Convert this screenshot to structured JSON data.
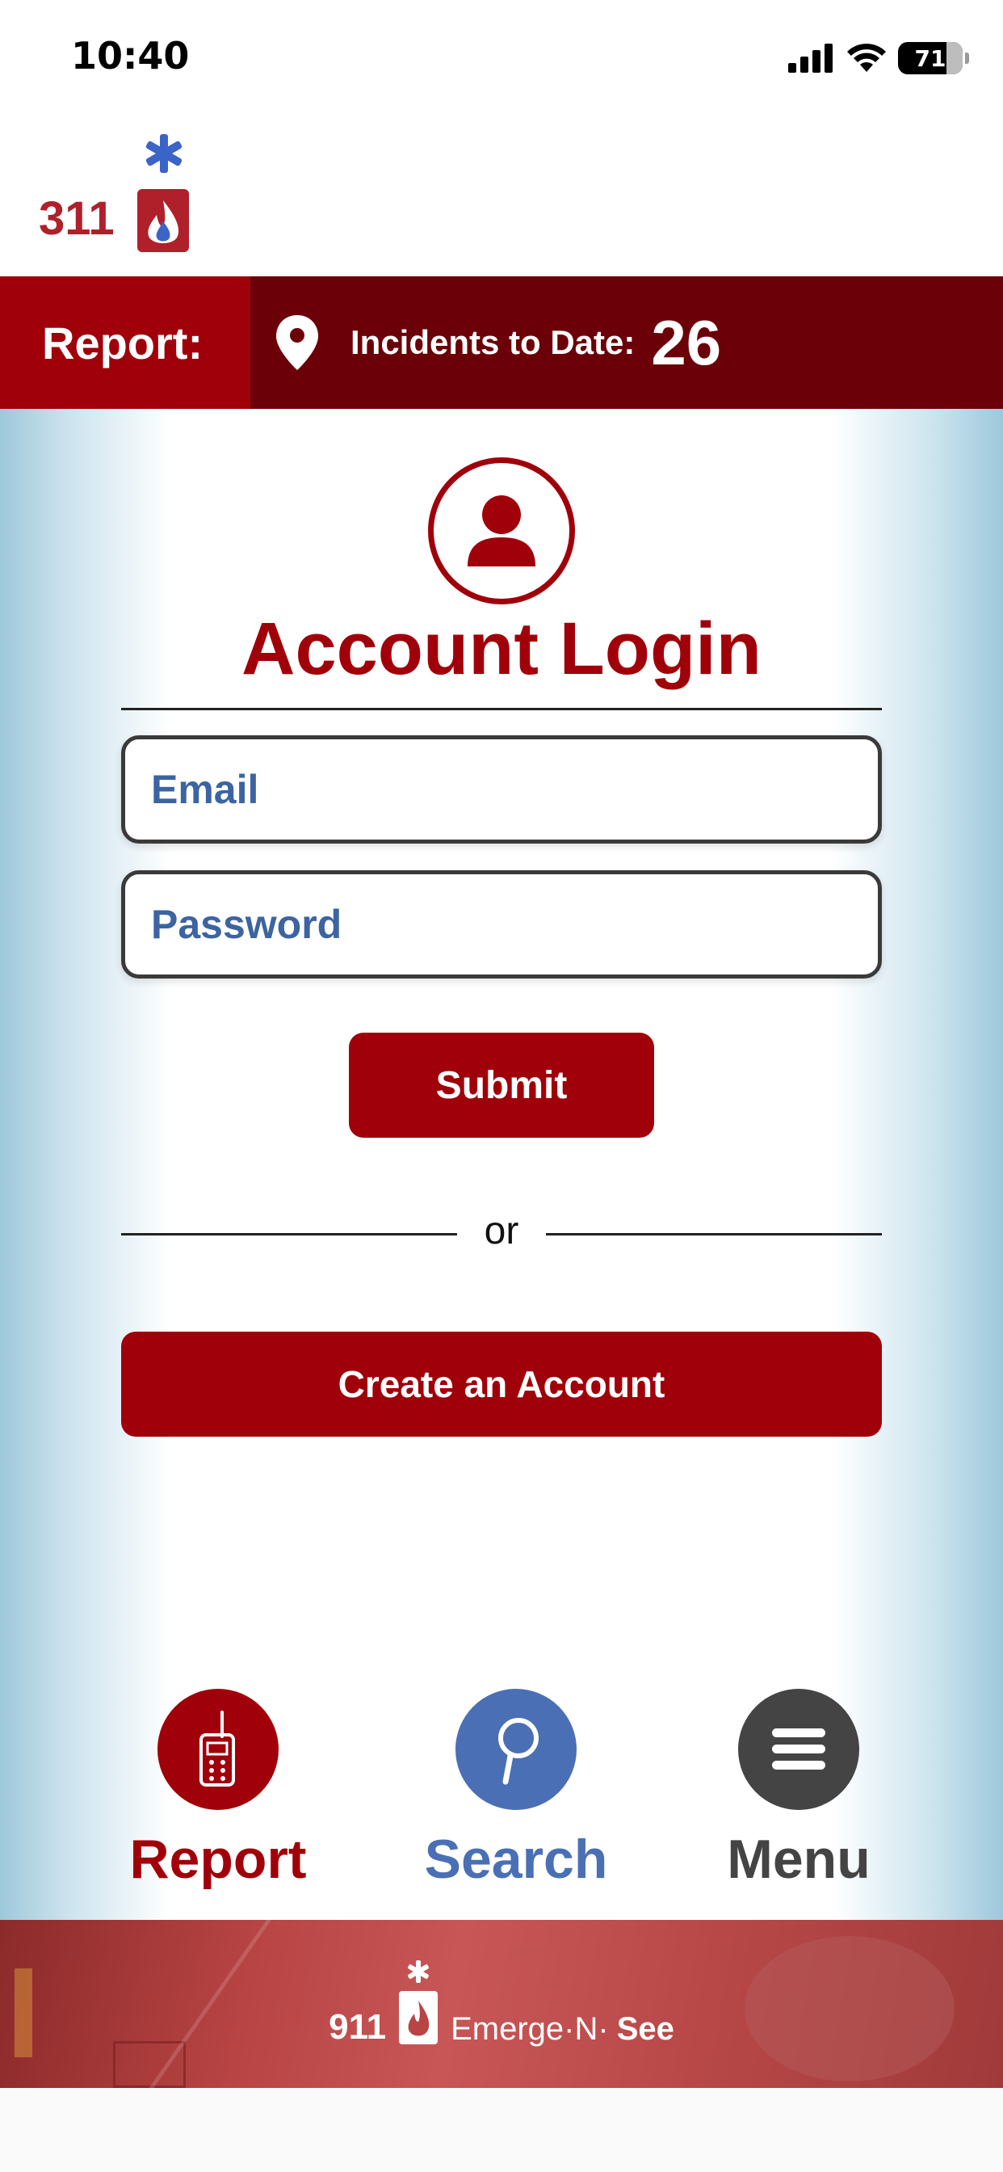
{
  "status_bar": {
    "time": "10:40",
    "battery": "71"
  },
  "header": {
    "logo_text": "311"
  },
  "report_bar": {
    "label": "Report:",
    "incidents_label": "Incidents to Date:",
    "incidents_count": "26"
  },
  "login": {
    "title": "Account Login",
    "email_placeholder": "Email",
    "password_placeholder": "Password",
    "submit_label": "Submit",
    "or_text": "or",
    "create_account_label": "Create an Account"
  },
  "bottom_nav": {
    "report_label": "Report",
    "search_label": "Search",
    "menu_label": "Menu"
  },
  "footer": {
    "brand_911": "911",
    "brand_emerge": "Emerge·N·",
    "brand_see": "See"
  },
  "colors": {
    "brand_red": "#a0000a",
    "dark_red": "#6b0008",
    "search_blue": "#4a6fb5",
    "menu_gray": "#444444",
    "input_text_blue": "#3c64a0"
  }
}
